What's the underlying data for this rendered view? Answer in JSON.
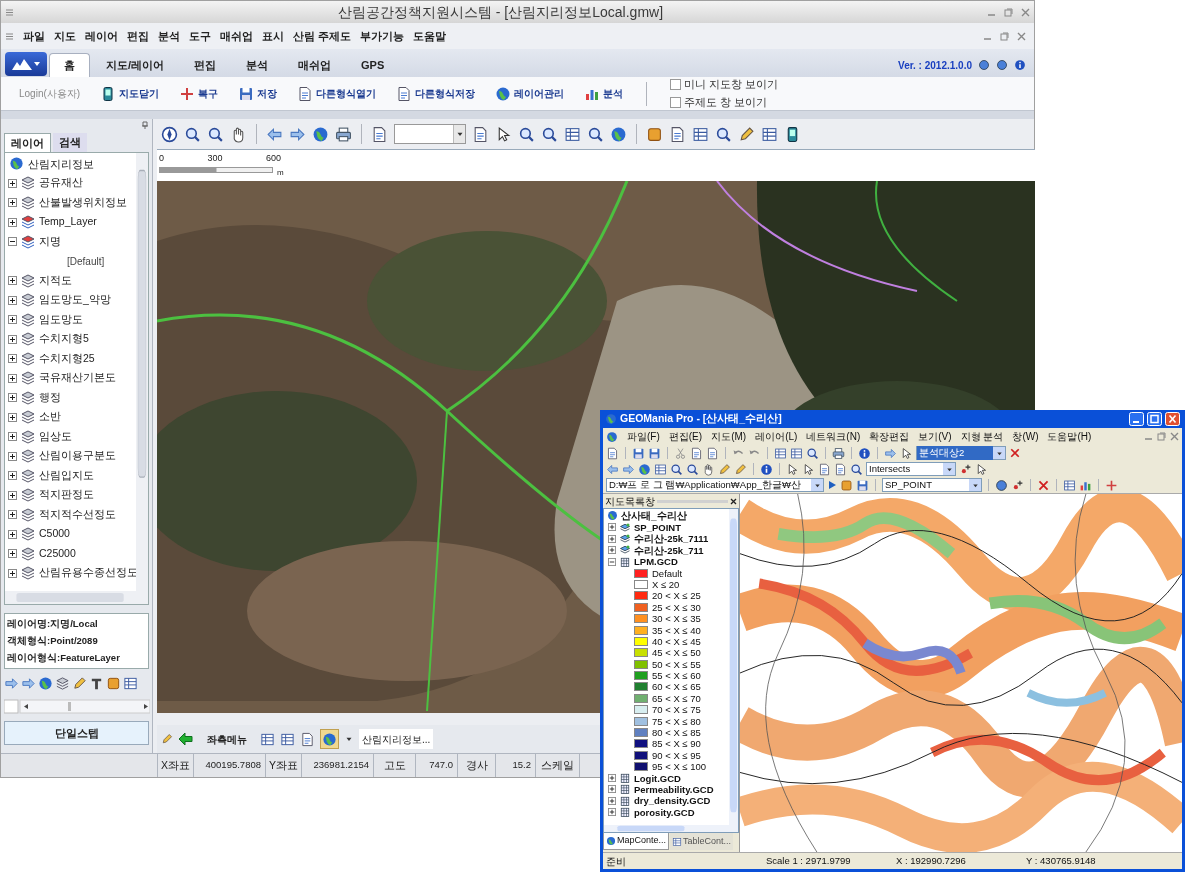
{
  "main_window": {
    "title": "산림공간정책지원시스템 - [산림지리정보Local.gmw]",
    "menu": [
      "파일",
      "지도",
      "레이어",
      "편집",
      "분석",
      "도구",
      "매쉬업",
      "표시",
      "산림 주제도",
      "부가기능",
      "도움말"
    ],
    "tabs": [
      {
        "label": "홈",
        "selected": true
      },
      {
        "label": "지도/레이어",
        "selected": false
      },
      {
        "label": "편집",
        "selected": false
      },
      {
        "label": "분석",
        "selected": false
      },
      {
        "label": "매쉬업",
        "selected": false
      },
      {
        "label": "GPS",
        "selected": false
      }
    ],
    "version": "Ver. : 2012.1.0.0",
    "ribbon": {
      "login": "Login(사용자)",
      "buttons": [
        "지도닫기",
        "복구",
        "저장",
        "다른형식열기",
        "다른형식저장",
        "레이어관리",
        "분석"
      ],
      "checkboxes": [
        {
          "label": "미니 지도창 보이기",
          "checked": false
        },
        {
          "label": "주제도 창 보이기",
          "checked": false
        }
      ]
    },
    "layer_panel": {
      "tabs": [
        {
          "label": "레이어",
          "selected": true
        },
        {
          "label": "검색",
          "selected": false
        }
      ],
      "root": "산림지리정보",
      "layers": [
        {
          "label": "공유재산",
          "expanded": false
        },
        {
          "label": "산불발생위치정보",
          "expanded": false
        },
        {
          "label": "Temp_Layer",
          "expanded": false
        },
        {
          "label": "지명",
          "expanded": true,
          "children": [
            {
              "label": "[Default]"
            }
          ]
        },
        {
          "label": "지적도",
          "expanded": false
        },
        {
          "label": "임도망도_약망",
          "expanded": false
        },
        {
          "label": "임도망도",
          "expanded": false
        },
        {
          "label": "수치지형5",
          "expanded": false
        },
        {
          "label": "수치지형25",
          "expanded": false
        },
        {
          "label": "국유재산기본도",
          "expanded": false
        },
        {
          "label": "행정",
          "expanded": false
        },
        {
          "label": "소반",
          "expanded": false
        },
        {
          "label": "임상도",
          "expanded": false
        },
        {
          "label": "산림이용구분도",
          "expanded": false
        },
        {
          "label": "산림입지도",
          "expanded": false
        },
        {
          "label": "적지판정도",
          "expanded": false
        },
        {
          "label": "적지적수선정도",
          "expanded": false
        },
        {
          "label": "C5000",
          "expanded": false
        },
        {
          "label": "C25000",
          "expanded": false
        },
        {
          "label": "산림유용수종선정도",
          "expanded": false
        }
      ],
      "info": [
        "레이어명:지명/Local",
        "객체형식:Point/2089",
        "레이어형식:FeatureLayer"
      ],
      "button": "단일스텝"
    },
    "map": {
      "scale_labels": [
        "0",
        "300",
        "600"
      ],
      "scale_unit": "m"
    },
    "map_footer": {
      "menu_label": "좌측메뉴",
      "layer_combo": "산림지리정보..."
    },
    "status_bar": [
      {
        "label": "X좌표",
        "value": "400195.7808"
      },
      {
        "label": "Y좌표",
        "value": "236981.2154"
      },
      {
        "label": "고도",
        "value": "747.0"
      },
      {
        "label": "경사",
        "value": "15.2"
      },
      {
        "label": "스케일"
      }
    ]
  },
  "geomania": {
    "title": "GEOMania Pro - [산사태_수리산]",
    "menu": [
      "파일(F)",
      "편집(E)",
      "지도(M)",
      "레이어(L)",
      "네트워크(N)",
      "확장편집",
      "보기(V)",
      "지형 분석",
      "창(W)",
      "도움말(H)"
    ],
    "target_combo": "분석대상2",
    "relation_combo": "Intersects",
    "path_combo": "D:₩프 로 그 램₩Application₩App_한글₩산",
    "layer_combo": "SP_POINT",
    "panel_title": "지도목록창",
    "root": "산사태_수리산",
    "layers": [
      {
        "label": "SP_POINT",
        "kind": "vector",
        "expanded": false
      },
      {
        "label": "수리산-25k_7111",
        "kind": "vector",
        "expanded": false
      },
      {
        "label": "수리산-25k_711",
        "kind": "vector",
        "expanded": false
      },
      {
        "label": "LPM.GCD",
        "kind": "grid",
        "expanded": true,
        "legend": [
          {
            "label": "Default",
            "color": "#ff2020"
          },
          {
            "label": "X ≤ 20",
            "color": "#ffffff"
          },
          {
            "label": "20 < X ≤ 25",
            "color": "#ff2a10"
          },
          {
            "label": "25 < X ≤ 30",
            "color": "#f06020"
          },
          {
            "label": "30 < X ≤ 35",
            "color": "#ff9020"
          },
          {
            "label": "35 < X ≤ 40",
            "color": "#ffb020"
          },
          {
            "label": "40 < X ≤ 45",
            "color": "#ffff00"
          },
          {
            "label": "45 < X ≤ 50",
            "color": "#c8e000"
          },
          {
            "label": "50 < X ≤ 55",
            "color": "#80c000"
          },
          {
            "label": "55 < X ≤ 60",
            "color": "#20a020"
          },
          {
            "label": "60 < X ≤ 65",
            "color": "#208030"
          },
          {
            "label": "65 < X ≤ 70",
            "color": "#70b070"
          },
          {
            "label": "70 < X ≤ 75",
            "color": "#d8eef0"
          },
          {
            "label": "75 < X ≤ 80",
            "color": "#a0c0e0"
          },
          {
            "label": "80 < X ≤ 85",
            "color": "#6080c0"
          },
          {
            "label": "85 < X ≤ 90",
            "color": "#101080"
          },
          {
            "label": "90 < X ≤ 95",
            "color": "#10107a"
          },
          {
            "label": "95 < X ≤ 100",
            "color": "#101070"
          }
        ]
      },
      {
        "label": "Logit.GCD",
        "kind": "grid",
        "expanded": false
      },
      {
        "label": "Permeability.GCD",
        "kind": "grid",
        "expanded": false
      },
      {
        "label": "dry_density.GCD",
        "kind": "grid",
        "expanded": false
      },
      {
        "label": "porosity.GCD",
        "kind": "grid",
        "expanded": false
      }
    ],
    "panel_tabs": [
      {
        "label": "MapConte...",
        "selected": true
      },
      {
        "label": "TableCont...",
        "selected": false
      }
    ],
    "status_bar": {
      "message": "준비",
      "scale": "Scale 1 : 2971.9799",
      "x": "X : 192990.7296",
      "y": "Y : 430765.9148"
    }
  }
}
